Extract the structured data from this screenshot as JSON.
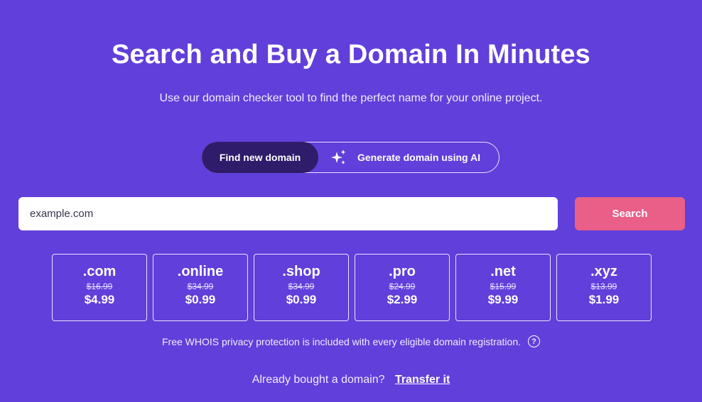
{
  "header": {
    "title": "Search and Buy a Domain In Minutes",
    "subtitle": "Use our domain checker tool to find the perfect name for your online project."
  },
  "mode_toggle": {
    "tabs": [
      {
        "label": "Find new domain",
        "active": true
      },
      {
        "label": "Generate domain using AI",
        "icon": "sparkles-icon",
        "active": false
      }
    ]
  },
  "search": {
    "placeholder": "example.com",
    "button_label": "Search"
  },
  "tlds": [
    {
      "name": ".com",
      "old_price": "$16.99",
      "price": "$4.99"
    },
    {
      "name": ".online",
      "old_price": "$34.99",
      "price": "$0.99"
    },
    {
      "name": ".shop",
      "old_price": "$34.99",
      "price": "$0.99"
    },
    {
      "name": ".pro",
      "old_price": "$24.99",
      "price": "$2.99"
    },
    {
      "name": ".net",
      "old_price": "$15.99",
      "price": "$9.99"
    },
    {
      "name": ".xyz",
      "old_price": "$13.99",
      "price": "$1.99"
    }
  ],
  "privacy": {
    "text": "Free WHOIS privacy protection is included with every eligible domain registration.",
    "icon": "?"
  },
  "transfer": {
    "question": "Already bought a domain?",
    "link_label": "Transfer it"
  },
  "colors": {
    "background": "#613FDA",
    "active_tab": "#2F1C6A",
    "search_button": "#E95F88"
  }
}
